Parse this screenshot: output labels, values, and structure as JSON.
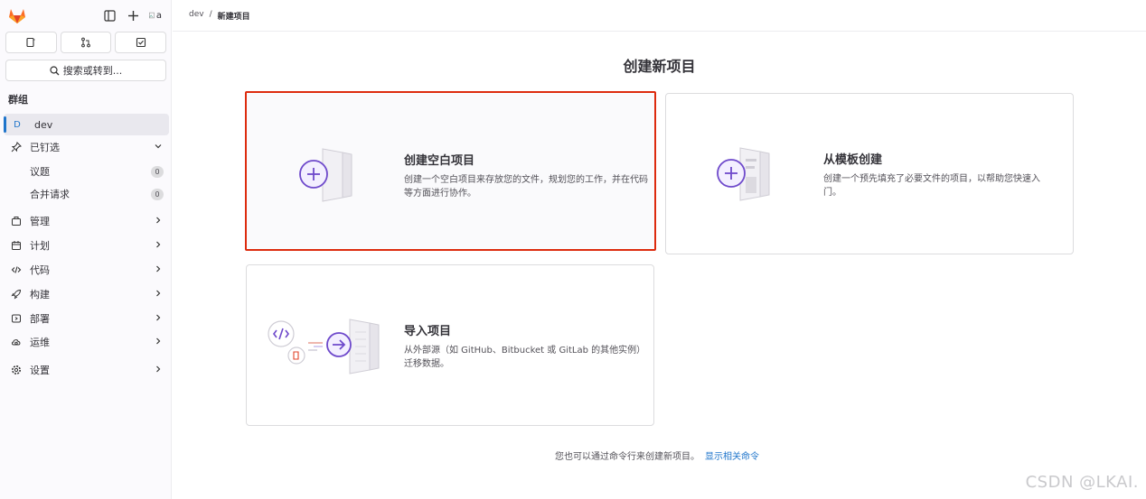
{
  "sidebar": {
    "search_label": "搜索或转到...",
    "section_label": "群组",
    "group": {
      "initial": "D",
      "name": "dev"
    },
    "pinned": {
      "label": "已钉选",
      "items": [
        {
          "label": "议题",
          "count": "0"
        },
        {
          "label": "合并请求",
          "count": "0"
        }
      ]
    },
    "nav": [
      {
        "label": "管理",
        "icon": "briefcase-icon"
      },
      {
        "label": "计划",
        "icon": "calendar-icon"
      },
      {
        "label": "代码",
        "icon": "code-icon"
      },
      {
        "label": "构建",
        "icon": "rocket-icon"
      },
      {
        "label": "部署",
        "icon": "deploy-icon"
      },
      {
        "label": "运维",
        "icon": "cloud-gear-icon"
      },
      {
        "label": "设置",
        "icon": "gear-icon"
      }
    ],
    "avatar_alt": "a"
  },
  "breadcrumb": {
    "parent": "dev",
    "sep": "/",
    "current": "新建项目"
  },
  "page": {
    "title": "创建新项目"
  },
  "cards": [
    {
      "title": "创建空白项目",
      "desc": "创建一个空白项目来存放您的文件，规划您的工作，并在代码等方面进行协作。"
    },
    {
      "title": "从模板创建",
      "desc": "创建一个预先填充了必要文件的项目，以帮助您快速入门。"
    },
    {
      "title": "导入项目",
      "desc": "从外部源（如 GitHub、Bitbucket 或 GitLab 的其他实例）迁移数据。"
    }
  ],
  "footer": {
    "note": "您也可以通过命令行来创建新项目。",
    "link": "显示相关命令"
  },
  "watermark": "CSDN @LKAI.",
  "colors": {
    "accent_purple": "#6e49cb",
    "selected_border": "#dd2b0e",
    "link": "#1f75cb"
  }
}
